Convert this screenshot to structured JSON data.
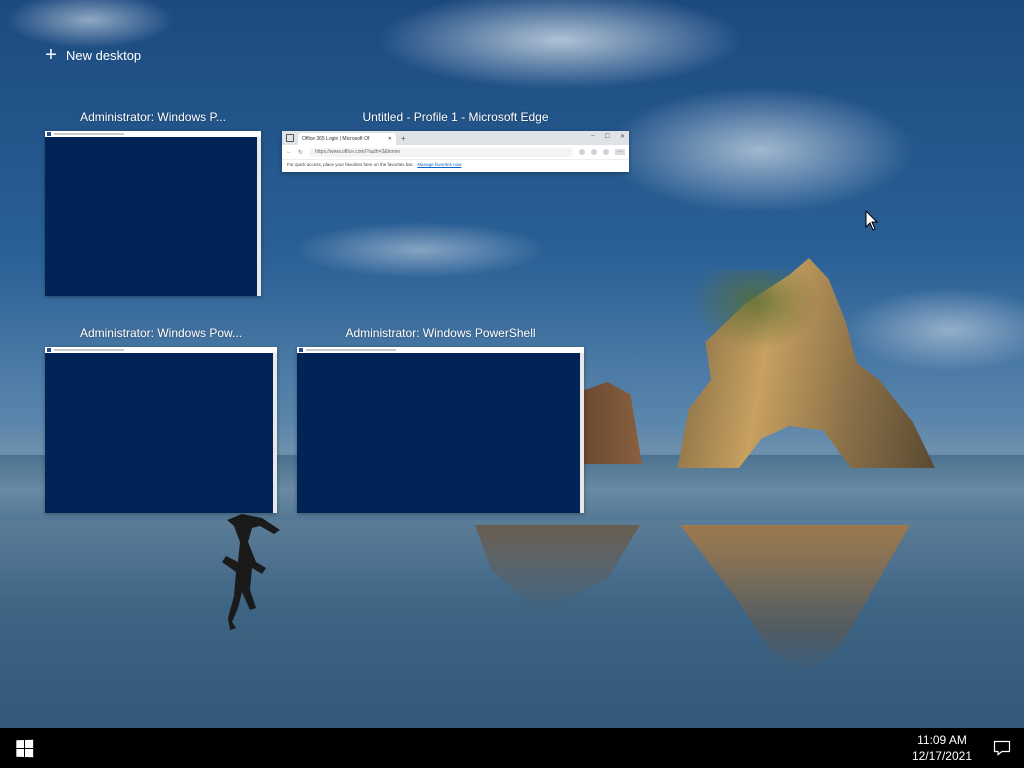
{
  "task_view": {
    "new_desktop_label": "New desktop",
    "windows": [
      {
        "title": "Administrator: Windows P...",
        "app": "powershell"
      },
      {
        "title": "Untitled - Profile 1 - Microsoft Edge",
        "app": "edge"
      },
      {
        "title": "Administrator: Windows Pow...",
        "app": "powershell"
      },
      {
        "title": "Administrator: Windows PowerShell",
        "app": "powershell"
      }
    ]
  },
  "edge_thumbnail": {
    "tab_title": "Office 365 Login | Microsoft Of",
    "url": "https://www.office.com/?auth=2&home",
    "favorites_text": "For quick access, place your favorites here on the favorites bar.",
    "favorites_link": "Manage favorites now"
  },
  "taskbar": {
    "time": "11:09 AM",
    "date": "12/17/2021"
  },
  "colors": {
    "powershell_bg": "#012456",
    "taskbar_bg": "#000000"
  }
}
